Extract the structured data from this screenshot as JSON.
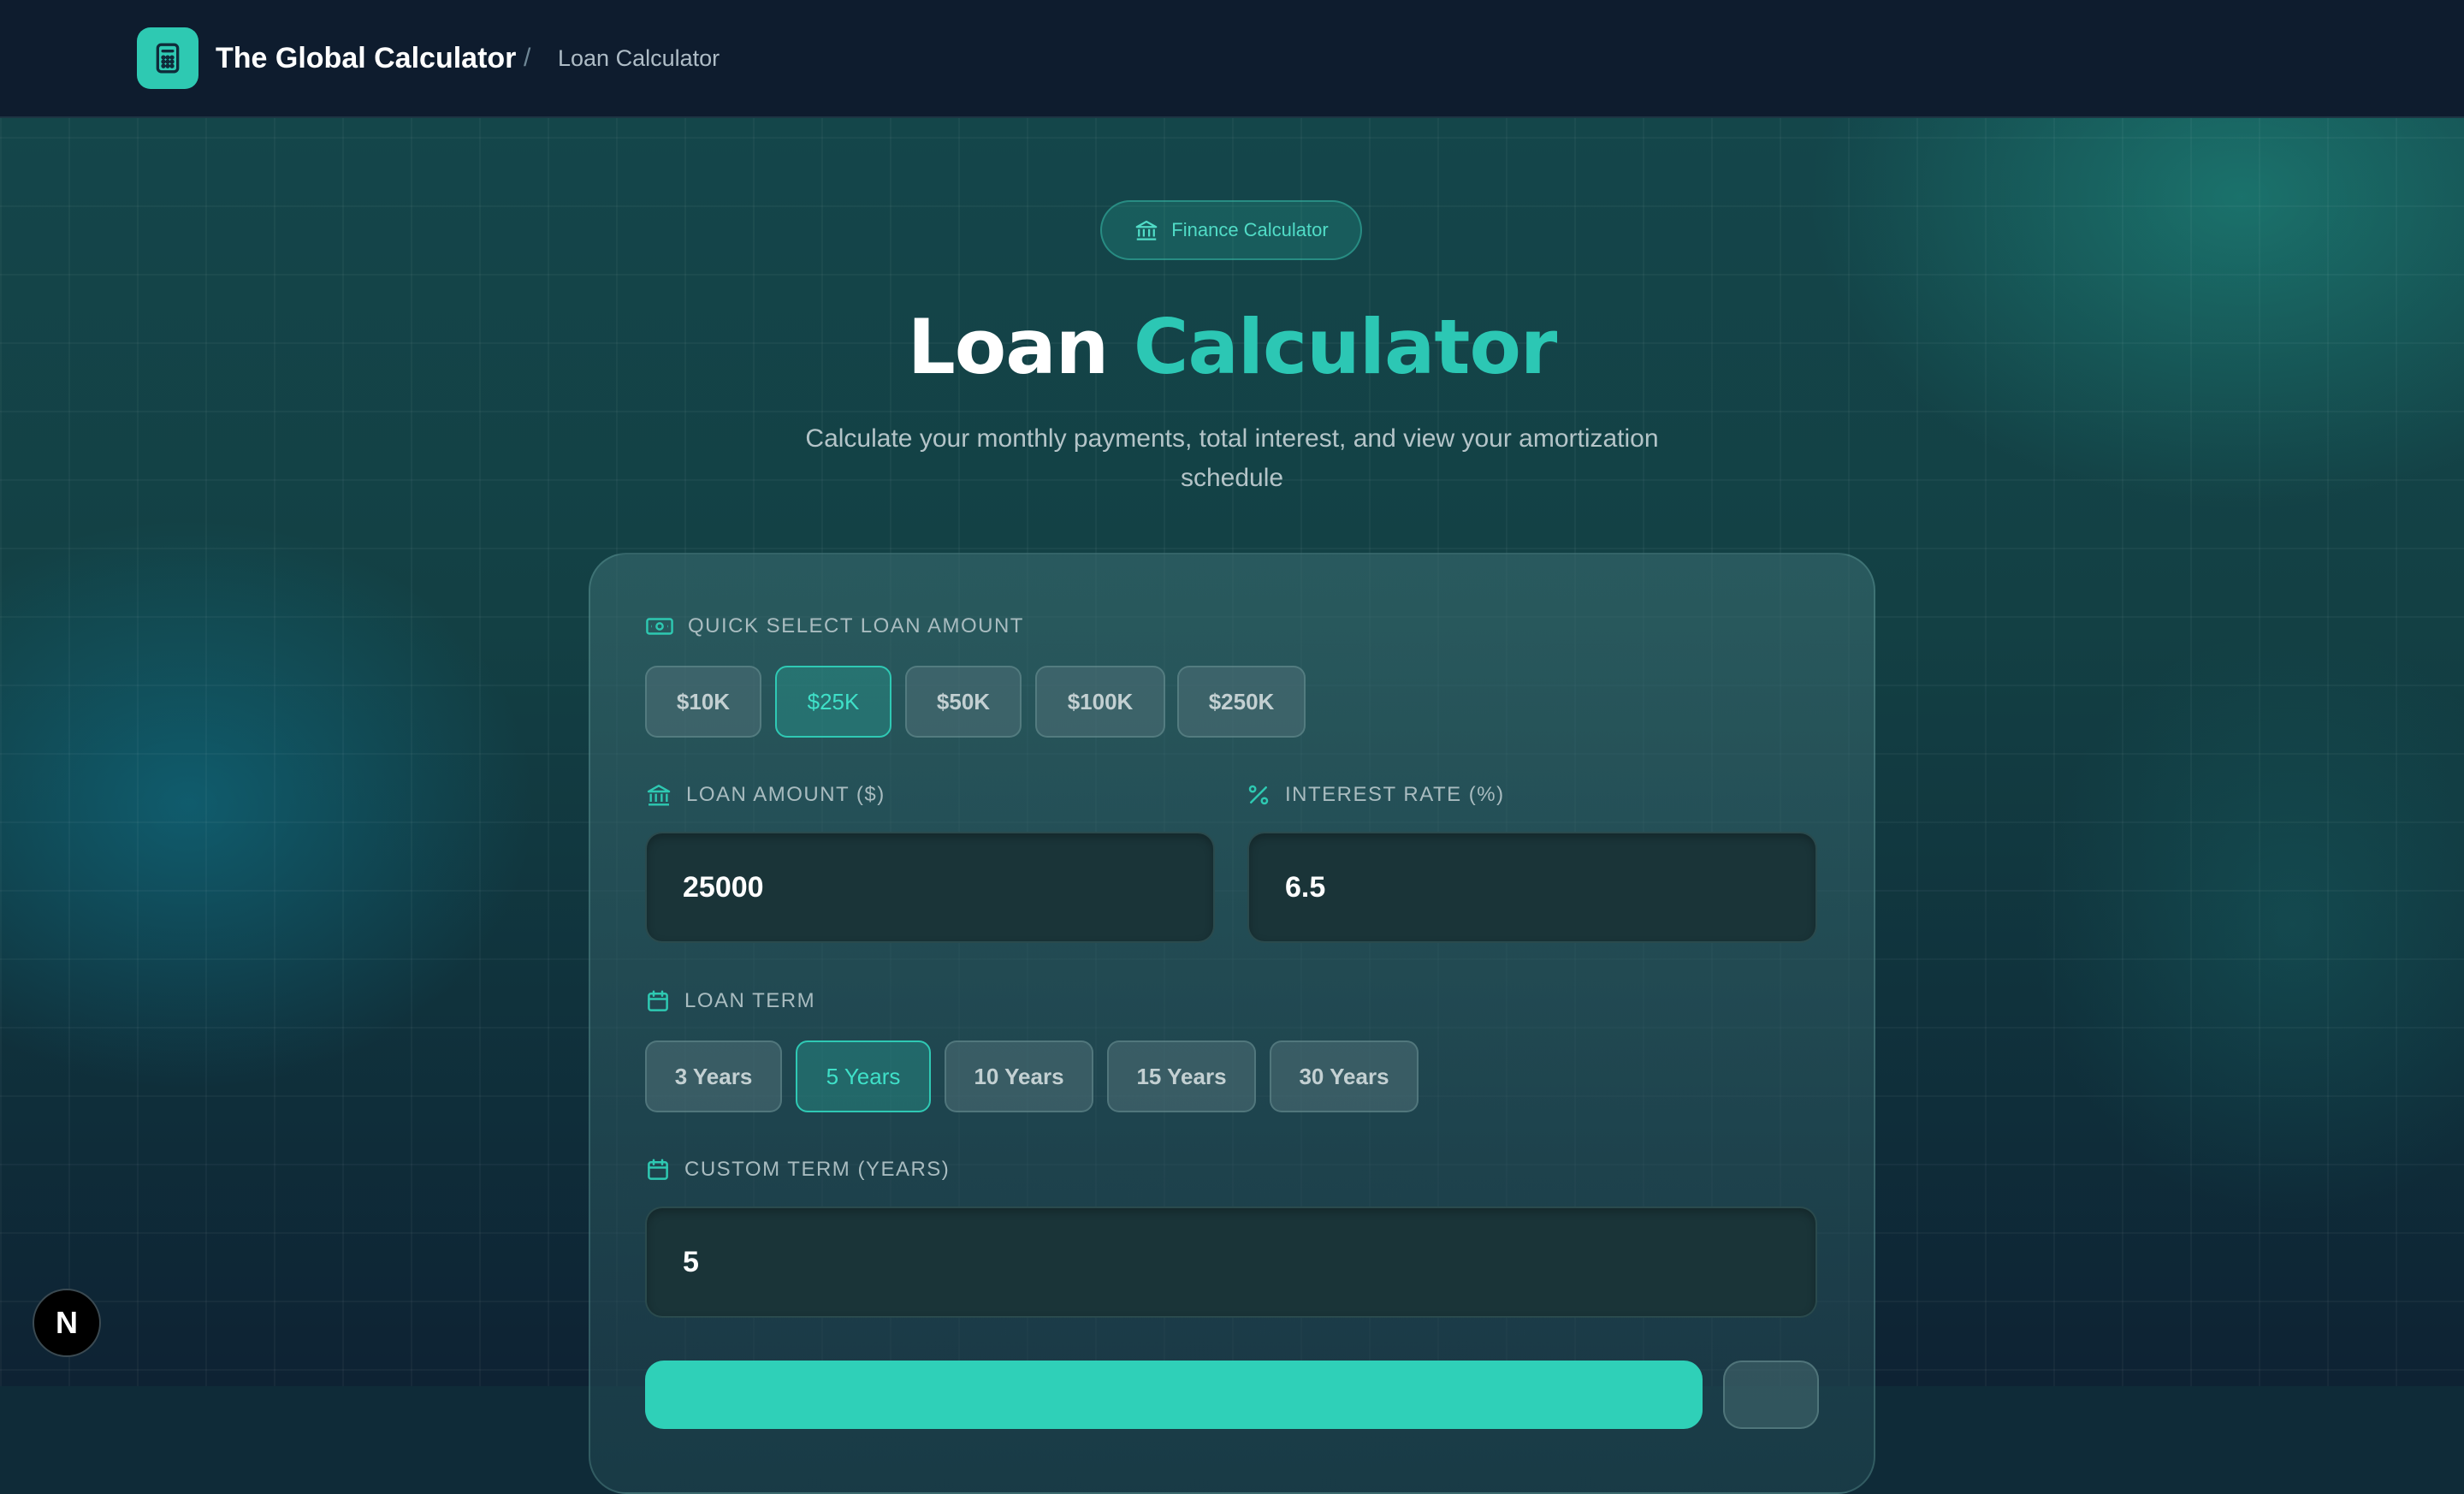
{
  "header": {
    "brand": "The Global Calculator",
    "separator": "/",
    "breadcrumb": "Loan Calculator"
  },
  "hero": {
    "badge": "Finance Calculator",
    "title_main": "Loan",
    "title_accent": "Calculator",
    "subtitle": "Calculate your monthly payments, total interest, and view your amortization schedule"
  },
  "form": {
    "quick_select_label": "Quick Select Loan Amount",
    "amount_options": [
      "$10K",
      "$25K",
      "$50K",
      "$100K",
      "$250K"
    ],
    "selected_amount": "$25K",
    "loan_amount_label": "Loan Amount ($)",
    "loan_amount_value": "25000",
    "interest_rate_label": "Interest Rate (%)",
    "interest_rate_value": "6.5",
    "loan_term_label": "Loan Term",
    "term_options": [
      "3 Years",
      "5 Years",
      "10 Years",
      "15 Years",
      "30 Years"
    ],
    "selected_term": "5 Years",
    "custom_term_label": "Custom Term (Years)",
    "custom_term_value": "5"
  },
  "dev_badge": {
    "letter": "N"
  },
  "colors": {
    "accent": "#2ec9b2",
    "header_bg": "#0e1c2e",
    "card_bg": "#2c5a60"
  },
  "icons": {
    "logo": "calculator-icon",
    "badge": "bank-icon",
    "quick_select": "banknote-icon",
    "loan_amount": "bank-icon",
    "interest_rate": "percent-icon",
    "loan_term": "calendar-icon",
    "custom_term": "calendar-icon"
  }
}
